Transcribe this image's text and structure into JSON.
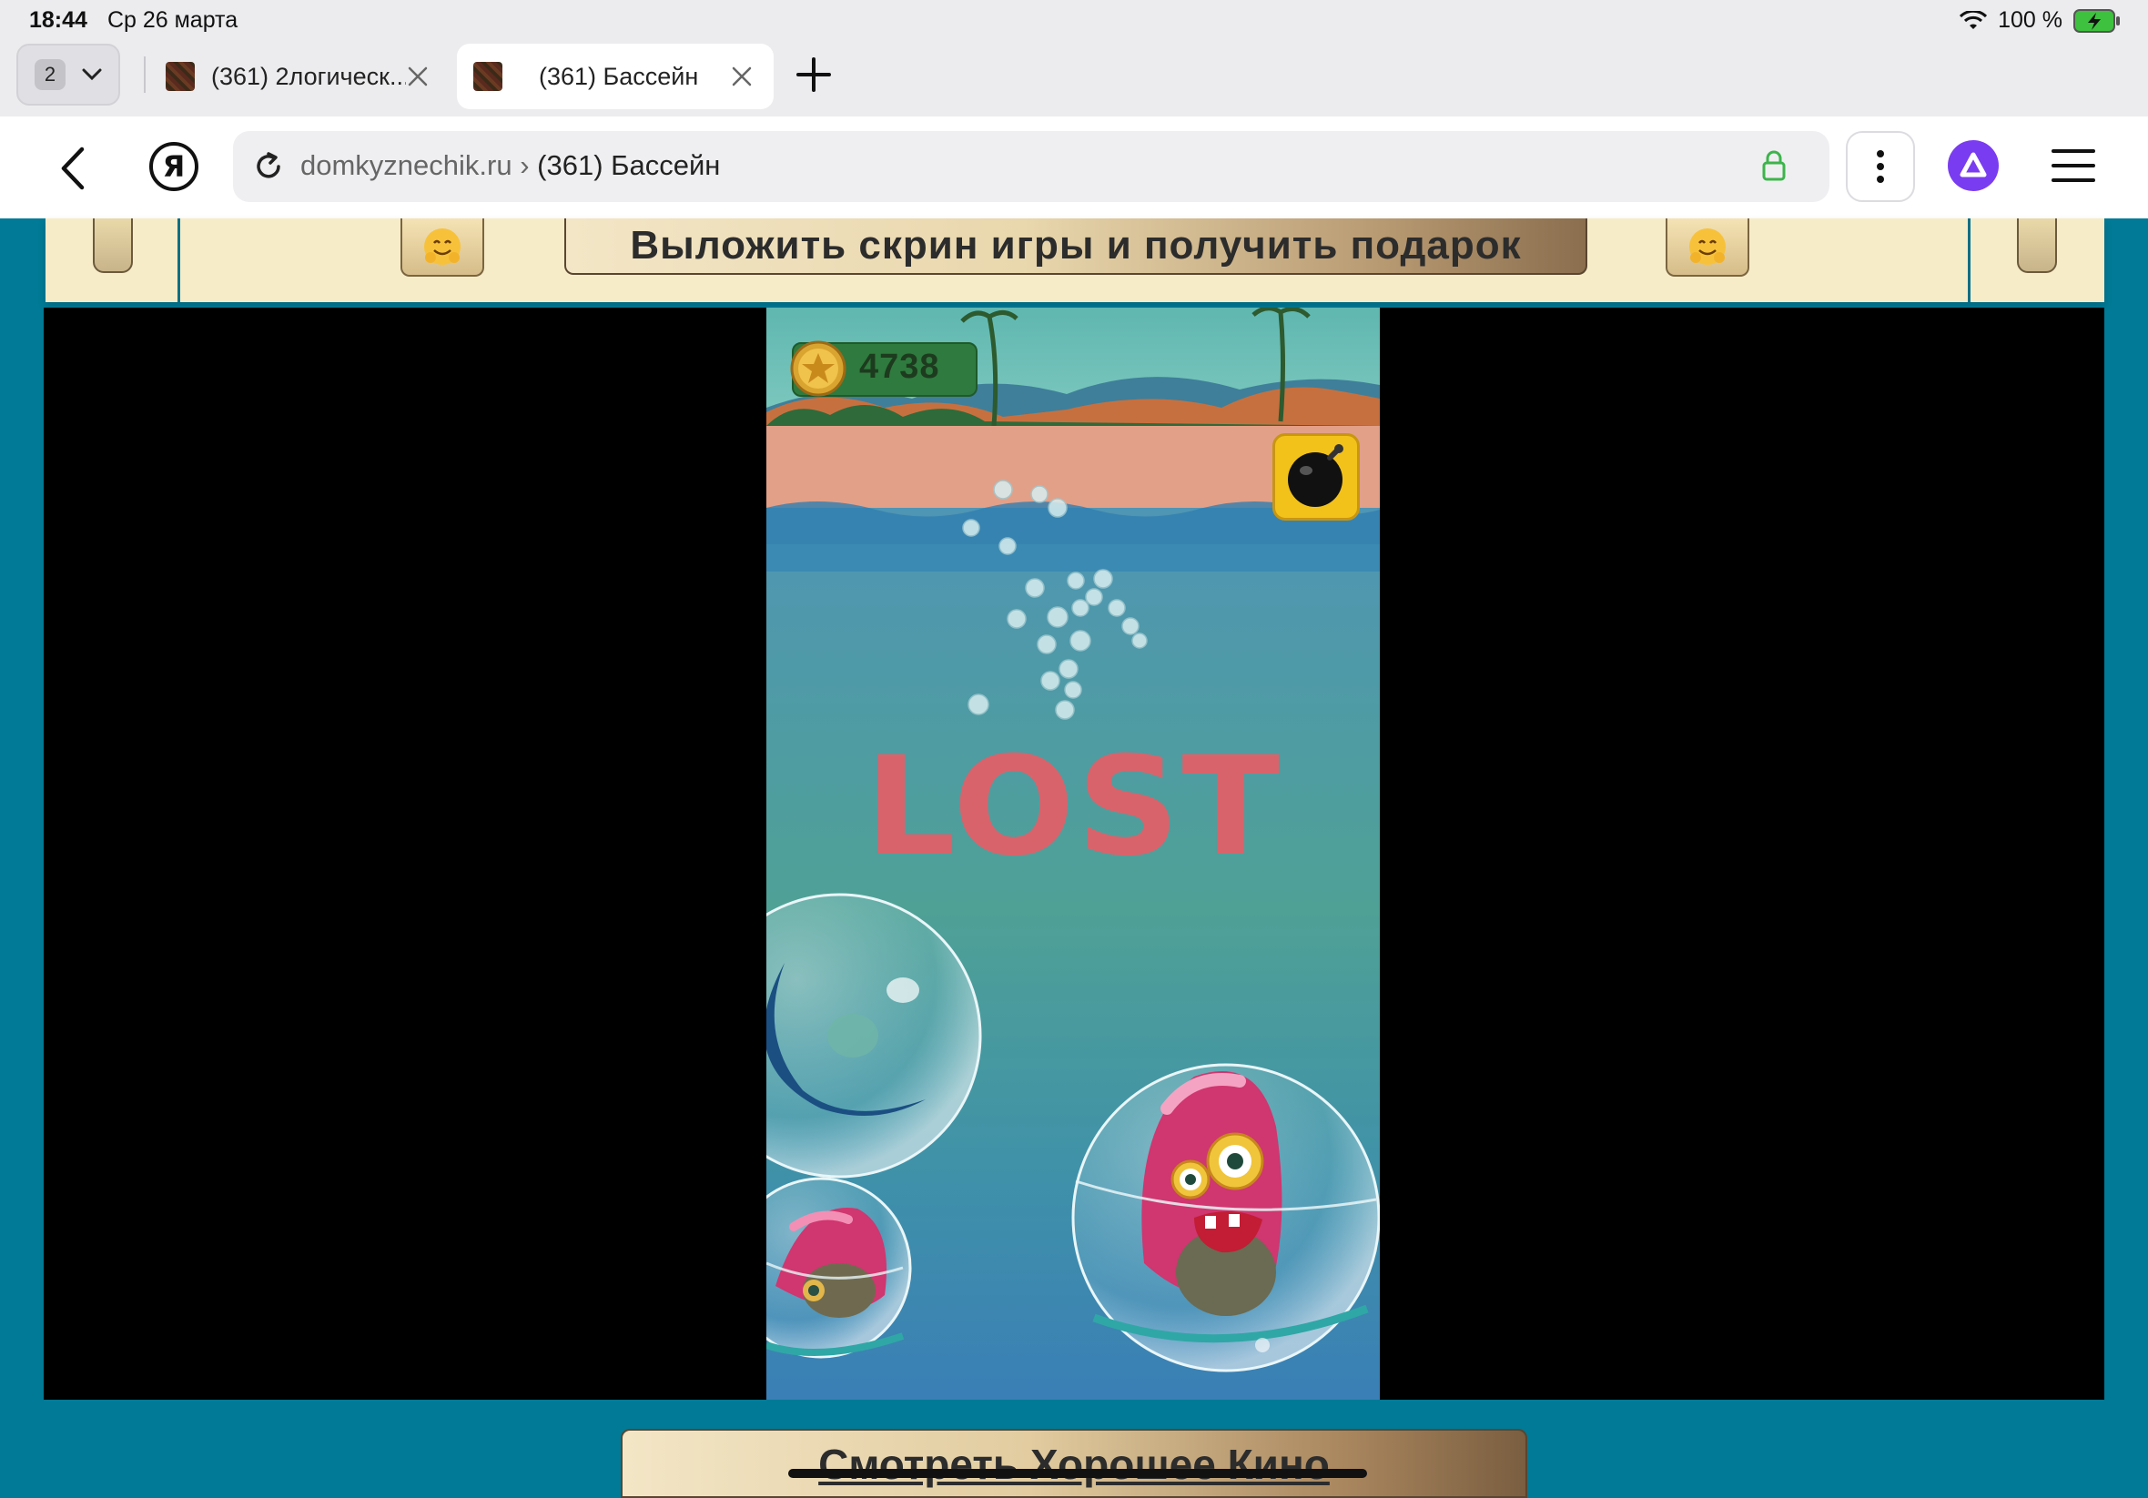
{
  "status": {
    "time": "18:44",
    "date": "Ср 26 марта",
    "battery": "100 %"
  },
  "tabs": {
    "count": "2",
    "items": [
      {
        "label": "(361) 2логическ..."
      },
      {
        "label": "(361) Бассейн"
      }
    ]
  },
  "address": {
    "domain": "domkyznechik.ru",
    "separator": " › ",
    "title": "(361) Бассейн"
  },
  "logo": {
    "letter": "Я"
  },
  "banner": {
    "button_label": "Выложить скрин игры и получить подарок"
  },
  "game": {
    "coins": "4738",
    "result": "LOST"
  },
  "footer": {
    "button_label": "Смотреть Хорошее Кино"
  },
  "colors": {
    "page_bg": "#007a96",
    "alice": "#7a3cf0",
    "lost": "#d9636b",
    "bomb_bg": "#f2c21b"
  }
}
